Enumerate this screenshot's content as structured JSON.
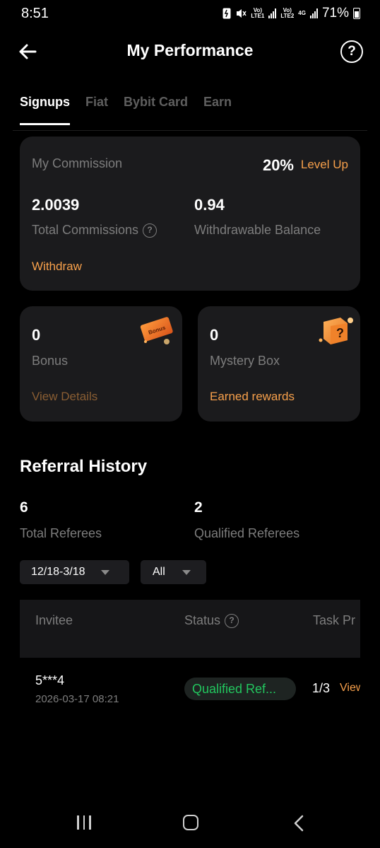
{
  "status_bar": {
    "time": "8:51",
    "net1": "Vo)\nLTE1",
    "net2": "Vo)\nLTE2",
    "net3": "4G",
    "battery": "71%"
  },
  "header": {
    "title": "My Performance"
  },
  "tabs": [
    {
      "label": "Signups",
      "active": true
    },
    {
      "label": "Fiat"
    },
    {
      "label": "Bybit Card"
    },
    {
      "label": "Earn"
    }
  ],
  "commission": {
    "title": "My Commission",
    "rate": "20%",
    "level_up": "Level Up",
    "total_value": "2.0039",
    "total_label": "Total Commissions",
    "withdrawable_value": "0.94",
    "withdrawable_label": "Withdrawable Balance",
    "withdraw": "Withdraw"
  },
  "bonus": {
    "value": "0",
    "label": "Bonus",
    "link": "View Details",
    "badge": "Bonus"
  },
  "mystery": {
    "value": "0",
    "label": "Mystery Box",
    "link": "Earned rewards"
  },
  "referral": {
    "title": "Referral History",
    "total_value": "6",
    "total_label": "Total Referees",
    "qualified_value": "2",
    "qualified_label": "Qualified Referees",
    "date_filter": "12/18-3/18",
    "status_filter": "All"
  },
  "table": {
    "headers": {
      "invitee": "Invitee",
      "status": "Status",
      "task": "Task Pr"
    },
    "rows": [
      {
        "invitee": "5***4",
        "date": "2026-03-17 08:21",
        "status": "Qualified Ref...",
        "progress": "1/3",
        "action": "View"
      }
    ]
  },
  "colors": {
    "accent": "#f7a04b",
    "success": "#22c55e",
    "card": "#1b1b1d"
  },
  "icons": [
    "back-arrow-icon",
    "help-icon",
    "question-icon",
    "bonus-ticket-icon",
    "mystery-box-icon",
    "caret-down-icon",
    "nav-recent-icon",
    "nav-home-icon",
    "nav-back-icon"
  ]
}
